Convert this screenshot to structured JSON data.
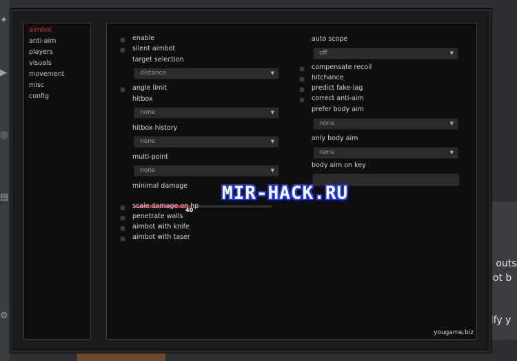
{
  "sidebar": {
    "items": [
      {
        "label": "aimbot",
        "active": true
      },
      {
        "label": "anti-aim"
      },
      {
        "label": "players"
      },
      {
        "label": "visuals"
      },
      {
        "label": "movement"
      },
      {
        "label": "misc"
      },
      {
        "label": "config"
      }
    ]
  },
  "left": {
    "enable": "enable",
    "silent_aimbot": "silent aimbot",
    "target_selection": {
      "label": "target selection",
      "value": "distance"
    },
    "angle_limit": "angle limit",
    "hitbox": {
      "label": "hitbox",
      "value": "none"
    },
    "hitbox_history": {
      "label": "hitbox history",
      "value": "none"
    },
    "multi_point": {
      "label": "multi-point",
      "value": "none"
    },
    "minimal_damage": {
      "label": "minimal damage",
      "value": "40",
      "fraction": 0.4
    },
    "scale_damage": "scale damage on hp",
    "penetrate_walls": "penetrate walls",
    "aimbot_knife": "aimbot with knife",
    "aimbot_taser": "aimbot with taser"
  },
  "right": {
    "auto_scope": {
      "label": "auto scope",
      "value": "off"
    },
    "compensate_recoil": "compensate recoil",
    "hitchance": "hitchance",
    "predict_fake_lag": "predict fake-lag",
    "correct_anti_aim": "correct anti-aim",
    "prefer_body_aim": {
      "label": "prefer body aim",
      "value": "none"
    },
    "only_body_aim": {
      "label": "only body aim",
      "value": "none"
    },
    "body_aim_on_key": {
      "label": "body aim on key"
    }
  },
  "brand": "yougame.biz",
  "watermark": "MIR-HACK.RU",
  "background_text": [
    "n outs",
    "not b",
    "rify y"
  ],
  "colors": {
    "accent": "#a3232c",
    "active_tab": "#c8303c"
  }
}
